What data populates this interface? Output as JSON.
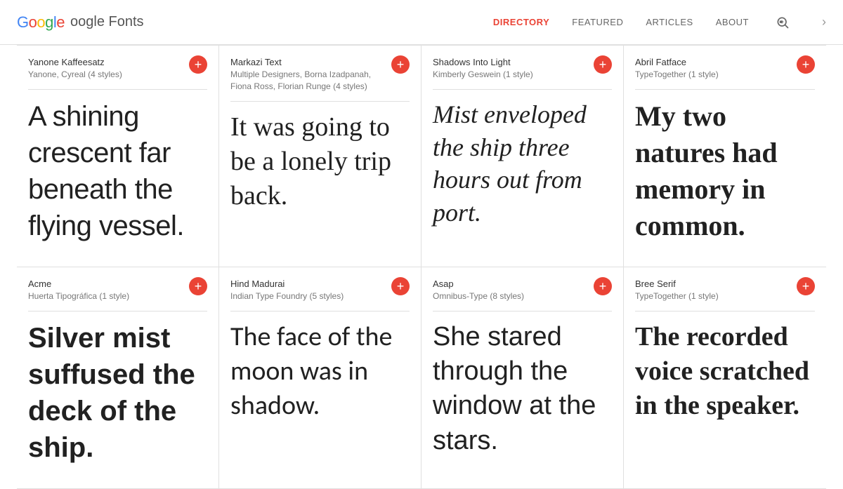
{
  "header": {
    "logo_g": "G",
    "logo_text": "oogle Fonts",
    "nav": {
      "directory": "DIRECTORY",
      "featured": "FEATURED",
      "articles": "ARTICLES",
      "about": "ABOUT"
    }
  },
  "fonts": [
    {
      "name": "Yanone Kaffeesatz",
      "meta": "Yanone, Cyreal (4 styles)",
      "preview": "A shining crescent far beneath the flying vessel.",
      "preview_class": "preview-yanone"
    },
    {
      "name": "Markazi Text",
      "meta": "Multiple Designers, Borna Izadpanah, Fiona Ross, Florian Runge (4 styles)",
      "preview": "It was going to be a lonely trip back.",
      "preview_class": "preview-markazi"
    },
    {
      "name": "Shadows Into Light",
      "meta": "Kimberly Geswein (1 style)",
      "preview": "Mist enveloped the ship three hours out from port.",
      "preview_class": "preview-shadows"
    },
    {
      "name": "Abril Fatface",
      "meta": "TypeTogether (1 style)",
      "preview": "My two natures had memory in common.",
      "preview_class": "preview-abril"
    },
    {
      "name": "Acme",
      "meta": "Huerta Tipográfica (1 style)",
      "preview": "Silver mist suffused the deck of the ship.",
      "preview_class": "preview-acme"
    },
    {
      "name": "Hind Madurai",
      "meta": "Indian Type Foundry (5 styles)",
      "preview": "The face of the moon was in shadow.",
      "preview_class": "preview-hind"
    },
    {
      "name": "Asap",
      "meta": "Omnibus-Type (8 styles)",
      "preview": "She stared through the window at the stars.",
      "preview_class": "preview-asap"
    },
    {
      "name": "Bree Serif",
      "meta": "TypeTogether (1 style)",
      "preview": "The recorded voice scratched in the speaker.",
      "preview_class": "preview-bree"
    }
  ],
  "add_label": "+"
}
